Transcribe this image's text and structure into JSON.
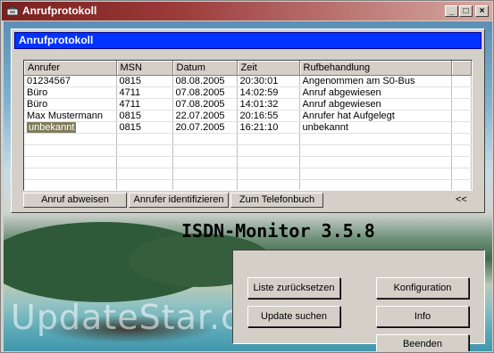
{
  "window": {
    "title": "Anrufprotokoll"
  },
  "panel": {
    "heading": "Anrufprotokoll"
  },
  "table": {
    "columns": [
      "Anrufer",
      "MSN",
      "Datum",
      "Zeit",
      "Rufbehandlung"
    ],
    "rows": [
      [
        "01234567",
        "0815",
        "08.08.2005",
        "20:30:01",
        "Angenommen am S0-Bus"
      ],
      [
        "Büro",
        "4711",
        "07.08.2005",
        "14:02:59",
        "Anruf abgewiesen"
      ],
      [
        "Büro",
        "4711",
        "07.08.2005",
        "14:01:32",
        "Anruf abgewiesen"
      ],
      [
        "Max Mustermann",
        "0815",
        "22.07.2005",
        "20:16:55",
        "Anrufer hat Aufgelegt"
      ],
      [
        "unbekannt",
        "0815",
        "20.07.2005",
        "16:21:10",
        "unbekannt"
      ]
    ]
  },
  "actions": {
    "reject": "Anruf abweisen",
    "identify": "Anrufer identifizieren",
    "phonebook": "Zum Telefonbuch",
    "collapse": "<<"
  },
  "product": {
    "version_label": "ISDN-Monitor 3.5.8"
  },
  "buttons": {
    "reset_list": "Liste zurücksetzen",
    "configuration": "Konfiguration",
    "search_update": "Update suchen",
    "info": "Info",
    "quit": "Beenden"
  },
  "watermark": "UpdateStar.com"
}
